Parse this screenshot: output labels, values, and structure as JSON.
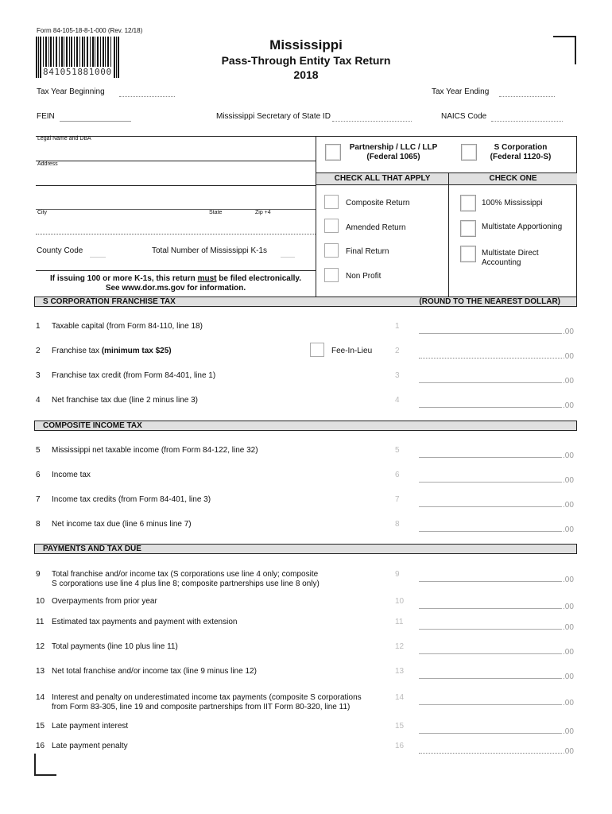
{
  "header": {
    "form_number": "Form 84-105-18-8-1-000 (Rev. 12/18)",
    "barcode_number": "841051881000",
    "state": "Mississippi",
    "title": "Pass-Through Entity Tax Return",
    "year": "2018"
  },
  "fields": {
    "tax_year_beginning": {
      "label": "Tax Year Beginning",
      "value": ""
    },
    "tax_year_ending": {
      "label": "Tax Year Ending",
      "value": ""
    },
    "fein": {
      "label": "FEIN",
      "value": ""
    },
    "sos_id": {
      "label": "Mississippi Secretary of State ID",
      "value": ""
    },
    "naics": {
      "label": "NAICS Code",
      "value": ""
    },
    "legal_name": {
      "label": "Legal Name and DBA",
      "value": ""
    },
    "address": {
      "label": "Address",
      "value": ""
    },
    "city": {
      "label": "City",
      "value": ""
    },
    "state": {
      "label": "State",
      "value": ""
    },
    "zip": {
      "label": "Zip +4",
      "value": ""
    },
    "county_code": {
      "label": "County Code",
      "value": ""
    },
    "k1_count": {
      "label": "Total Number of Mississippi K-1s",
      "value": ""
    }
  },
  "notice": {
    "line1_pre": "If issuing 100 or more K-1s, this return ",
    "line1_must": "must",
    "line1_post": " be filed electronically.",
    "line2": "See www.dor.ms.gov for information."
  },
  "entity_type": {
    "partnership": {
      "line1": "Partnership / LLC / LLP",
      "line2": "(Federal 1065)",
      "checked": false
    },
    "scorp": {
      "line1": "S Corporation",
      "line2": "(Federal 1120-S)",
      "checked": false
    }
  },
  "check_all": {
    "header": "CHECK ALL THAT APPLY",
    "items": [
      {
        "label": "Composite Return",
        "checked": false
      },
      {
        "label": "Amended Return",
        "checked": false
      },
      {
        "label": "Final Return",
        "checked": false
      },
      {
        "label": "Non Profit",
        "checked": false
      }
    ]
  },
  "check_one": {
    "header": "CHECK ONE",
    "items": [
      {
        "label": "100% Mississippi",
        "checked": false
      },
      {
        "label": "Multistate Apportioning",
        "checked": false
      },
      {
        "label": "Multistate Direct",
        "label2": "Accounting",
        "checked": false
      }
    ]
  },
  "sections": {
    "franchise": {
      "title": "S CORPORATION FRANCHISE TAX",
      "note": "(ROUND TO THE NEAREST DOLLAR)"
    },
    "composite": {
      "title": "COMPOSITE INCOME TAX"
    },
    "payments": {
      "title": "PAYMENTS AND TAX DUE"
    }
  },
  "fee_in_lieu": {
    "label": "Fee-In-Lieu",
    "checked": false
  },
  "cents_suffix": ".00",
  "lines": [
    {
      "num": "1",
      "text": "Taxable capital (from Form 84-110, line 18)",
      "value": ""
    },
    {
      "num": "2",
      "text": "Franchise tax ",
      "bold": "(minimum tax $25)",
      "value": ""
    },
    {
      "num": "3",
      "text": "Franchise tax credit (from Form 84-401, line 1)",
      "value": ""
    },
    {
      "num": "4",
      "text": "Net franchise tax due (line 2 minus line 3)",
      "value": ""
    },
    {
      "num": "5",
      "text": "Mississippi net taxable income (from Form 84-122, line 32)",
      "value": ""
    },
    {
      "num": "6",
      "text": "Income tax",
      "value": ""
    },
    {
      "num": "7",
      "text": "Income tax credits (from Form 84-401, line 3)",
      "value": ""
    },
    {
      "num": "8",
      "text": "Net income tax due (line 6 minus line 7)",
      "value": ""
    },
    {
      "num": "9",
      "text": "Total franchise and/or income tax (S corporations use line 4 only; composite",
      "text2": "S corporations use line 4 plus line 8; composite partnerships use line 8 only)",
      "value": ""
    },
    {
      "num": "10",
      "text": "Overpayments from prior year",
      "value": ""
    },
    {
      "num": "11",
      "text": "Estimated tax payments and payment with extension",
      "value": ""
    },
    {
      "num": "12",
      "text": "Total payments (line 10 plus line 11)",
      "value": ""
    },
    {
      "num": "13",
      "text": "Net total franchise and/or income tax (line 9 minus line 12)",
      "value": ""
    },
    {
      "num": "14",
      "text": "Interest and penalty on underestimated income tax payments (composite S corporations",
      "text2": "from Form 83-305, line 19 and composite partnerships from IIT Form 80-320, line 11)",
      "value": ""
    },
    {
      "num": "15",
      "text": "Late payment interest",
      "value": ""
    },
    {
      "num": "16",
      "text": "Late payment penalty",
      "value": ""
    }
  ]
}
